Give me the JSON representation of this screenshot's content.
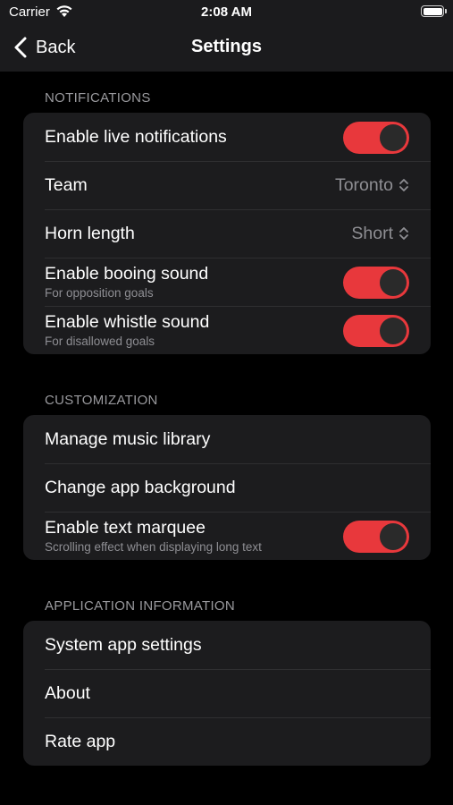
{
  "status_bar": {
    "carrier": "Carrier",
    "time": "2:08 AM"
  },
  "nav": {
    "back_label": "Back",
    "title": "Settings"
  },
  "colors": {
    "accent": "#e8383c",
    "background": "#000000",
    "group_bg": "#1c1c1e",
    "secondary_text": "#8e8e93"
  },
  "sections": {
    "notifications": {
      "header": "NOTIFICATIONS",
      "live": {
        "label": "Enable live notifications",
        "on": true
      },
      "team": {
        "label": "Team",
        "value": "Toronto"
      },
      "horn": {
        "label": "Horn length",
        "value": "Short"
      },
      "booing": {
        "label": "Enable booing sound",
        "sublabel": "For opposition goals",
        "on": true
      },
      "whistle": {
        "label": "Enable whistle sound",
        "sublabel": "For disallowed goals",
        "on": true
      }
    },
    "customization": {
      "header": "CUSTOMIZATION",
      "music": {
        "label": "Manage music library"
      },
      "background": {
        "label": "Change app background"
      },
      "marquee": {
        "label": "Enable text marquee",
        "sublabel": "Scrolling effect when displaying long text",
        "on": true
      }
    },
    "app_info": {
      "header": "APPLICATION INFORMATION",
      "system": {
        "label": "System app settings"
      },
      "about": {
        "label": "About"
      },
      "rate": {
        "label": "Rate app"
      }
    }
  }
}
